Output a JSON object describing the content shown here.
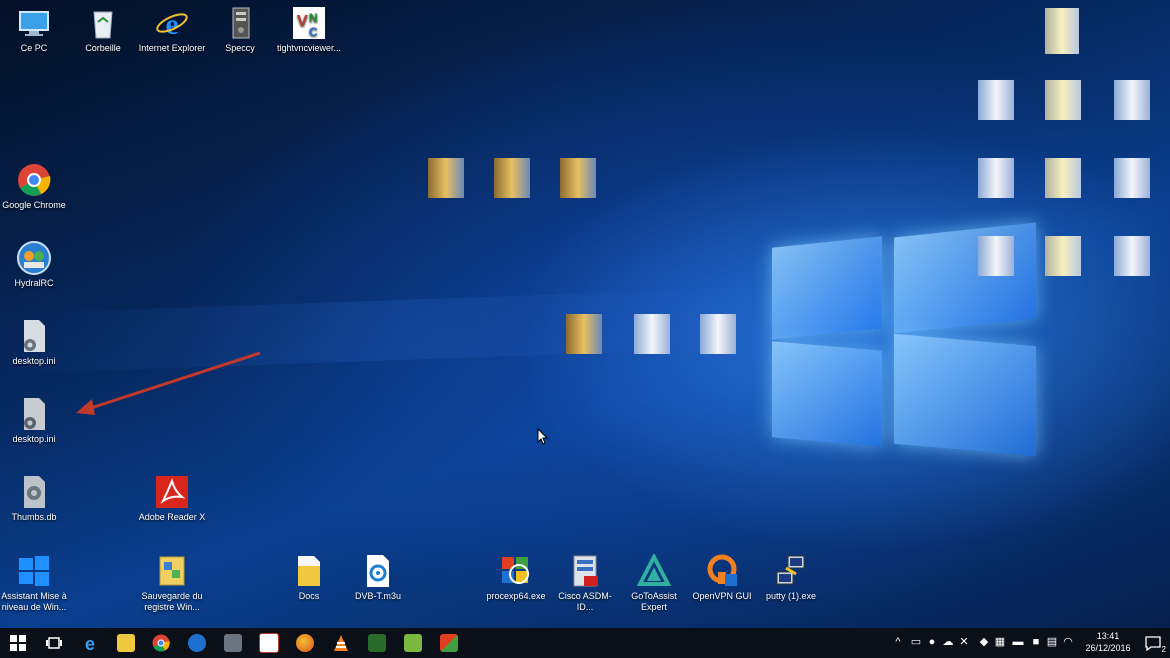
{
  "desktop_icons": {
    "ce_pc": "Ce PC",
    "corbeille": "Corbeille",
    "internet_explorer": "Internet Explorer",
    "speccy": "Speccy",
    "tightvnc": "tightvncviewer...",
    "google_chrome": "Google Chrome",
    "hydralrc": "HydralRC",
    "desktop_ini_1": "desktop.ini",
    "desktop_ini_2": "desktop.ini",
    "thumbs_db": "Thumbs.db",
    "adobe_reader": "Adobe Reader X",
    "assistant_mise": "Assistant Mise à niveau de Win...",
    "sauvegarde": "Sauvegarde du registre Win...",
    "docs": "Docs",
    "dvbt": "DVB-T.m3u",
    "procexp": "procexp64.exe",
    "cisco": "Cisco ASDM-ID...",
    "gotoassist": "GoToAssist Expert",
    "openvpn": "OpenVPN GUI",
    "putty": "putty (1).exe"
  },
  "taskbar": {
    "clock_time": "13:41",
    "clock_date": "26/12/2016",
    "notification_count": "2"
  },
  "colors": {
    "taskbar_bg": "#0b0f17",
    "arrow": "#c0392b"
  }
}
